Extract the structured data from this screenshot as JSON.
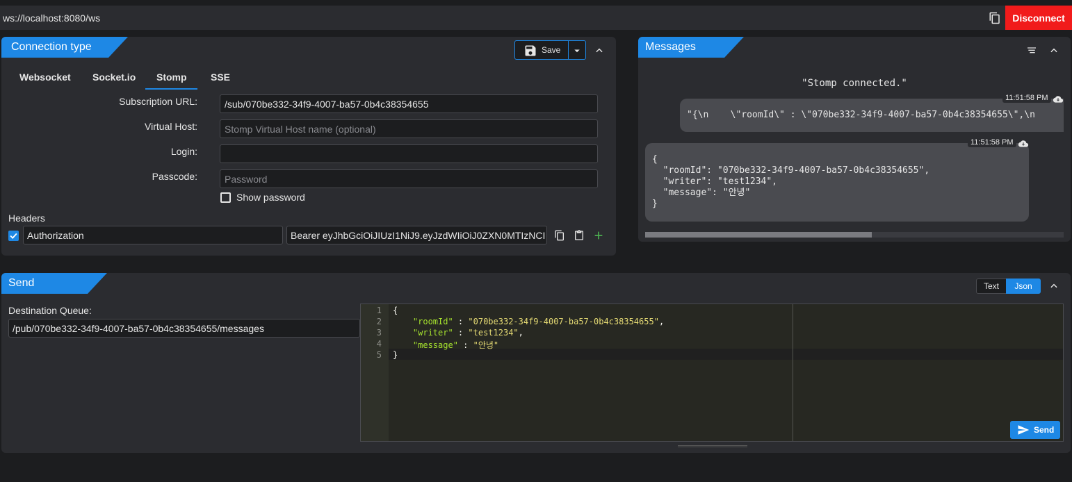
{
  "topbar": {
    "url": "ws://localhost:8080/ws",
    "disconnect_label": "Disconnect",
    "disconnect_color": "#f11b1b"
  },
  "connection": {
    "title": "Connection type",
    "save_label": "Save",
    "tabs": [
      "Websocket",
      "Socket.io",
      "Stomp",
      "SSE"
    ],
    "active_tab": "Stomp",
    "fields": {
      "subscription_url_label": "Subscription URL:",
      "subscription_url_value": "/sub/070be332-34f9-4007-ba57-0b4c38354655",
      "virtual_host_label": "Virtual Host:",
      "virtual_host_placeholder": "Stomp Virtual Host name (optional)",
      "login_label": "Login:",
      "login_value": "",
      "passcode_label": "Passcode:",
      "passcode_placeholder": "Password",
      "show_password_label": "Show password"
    },
    "headers_label": "Headers",
    "header": {
      "enabled": true,
      "key": "Authorization",
      "value": "Bearer eyJhbGciOiJIUzI1NiJ9.eyJzdWIiOiJ0ZXN0MTIzNCI"
    }
  },
  "messages": {
    "title": "Messages",
    "status": "\"Stomp connected.\"",
    "items": [
      {
        "time": "11:51:58 PM",
        "text": "\"{\\n    \\\"roomId\\\" : \\\"070be332-34f9-4007-ba57-0b4c38354655\\\",\\n"
      },
      {
        "time": "11:51:58 PM",
        "text": "{\n  \"roomId\": \"070be332-34f9-4007-ba57-0b4c38354655\",\n  \"writer\": \"test1234\",\n  \"message\": \"안녕\"\n}"
      }
    ]
  },
  "send": {
    "title": "Send",
    "destination_label": "Destination Queue:",
    "destination_value": "/pub/070be332-34f9-4007-ba57-0b4c38354655/messages",
    "format_options": [
      "Text",
      "Json"
    ],
    "format_selected": "Json",
    "send_label": "Send",
    "editor_lines": [
      {
        "n": "1",
        "raw": "{"
      },
      {
        "n": "2",
        "key": "\"roomId\"",
        "val": "\"070be332-34f9-4007-ba57-0b4c38354655\""
      },
      {
        "n": "3",
        "key": "\"writer\"",
        "val": "\"test1234\""
      },
      {
        "n": "4",
        "key": "\"message\"",
        "val": "\"안녕\""
      },
      {
        "n": "5",
        "raw": "}"
      }
    ]
  },
  "colors": {
    "accent": "#1e88e5",
    "panel": "#2b2c30",
    "background": "#1c1d1f"
  }
}
